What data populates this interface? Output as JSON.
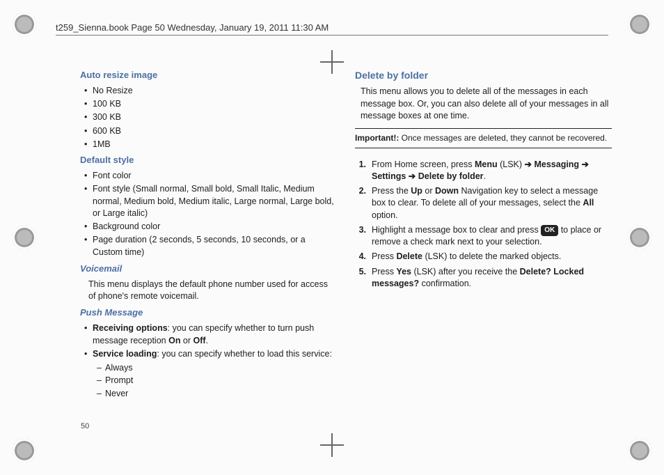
{
  "header": "t259_Sienna.book  Page 50  Wednesday, January 19, 2011  11:30 AM",
  "page_number": "50",
  "left": {
    "auto_resize": {
      "title": "Auto resize image",
      "items": [
        "No Resize",
        "100 KB",
        "300 KB",
        "600 KB",
        "1MB"
      ]
    },
    "default_style": {
      "title": "Default style",
      "items": [
        "Font color",
        "Font style (Small normal, Small bold, Small Italic, Medium normal, Medium bold, Medium italic, Large normal, Large bold, or Large italic)",
        "Background color",
        "Page duration (2 seconds, 5 seconds, 10 seconds, or a Custom time)"
      ]
    },
    "voicemail": {
      "title": "Voicemail",
      "body": "This menu displays the default phone number used for access of phone's remote voicemail."
    },
    "push": {
      "title": "Push Message",
      "recv_label": "Receiving options",
      "recv_body": ": you can specify whether to turn push message reception ",
      "on": "On",
      "or": " or ",
      "off": "Off",
      "svc_label": "Service loading",
      "svc_body": ": you can specify whether to load this service:",
      "svc_opts": [
        "Always",
        "Prompt",
        "Never"
      ]
    }
  },
  "right": {
    "delete": {
      "title": "Delete by folder",
      "intro": "This menu allows you to delete all of the messages in each message box. Or, you can also delete all of your messages in all message boxes at one time.",
      "important_label": "Important!:",
      "important_body": " Once messages are deleted, they cannot be recovered.",
      "steps": {
        "s1_a": "From Home screen, press ",
        "s1_menu": "Menu",
        "s1_lsk": " (LSK) ",
        "arrow": "➔",
        "s1_msg": " Messaging ",
        "s1_set": " Settings ",
        "s1_dbf": " Delete by folder",
        "s2_a": "Press the ",
        "s2_up": "Up",
        "s2_or": " or ",
        "s2_down": "Down",
        "s2_b": " Navigation key to select a message box to clear. To delete all of your messages, select the ",
        "s2_all": "All",
        "s2_c": " option.",
        "s3_a": "Highlight a message box to clear and press ",
        "s3_ok": "OK",
        "s3_b": " to place or remove a check mark next to your selection.",
        "s4_a": "Press ",
        "s4_del": "Delete",
        "s4_b": " (LSK) to delete the marked objects.",
        "s5_a": "Press ",
        "s5_yes": "Yes",
        "s5_b": " (LSK) after you receive the ",
        "s5_dlm": "Delete? Locked messages?",
        "s5_c": " confirmation."
      }
    }
  }
}
